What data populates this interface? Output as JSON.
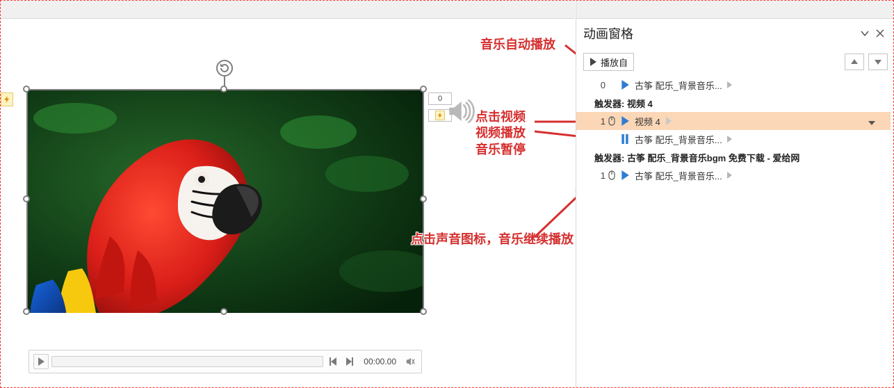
{
  "slide": {
    "index_label_1": "0",
    "index_label_2": "",
    "video_time": "00:00.00"
  },
  "annotations": {
    "auto_play": "音乐自动播放",
    "click_video_l1": "点击视频",
    "click_video_l2": "视频播放",
    "click_video_l3": "音乐暂停",
    "click_sound": "点击声音图标，音乐继续播放"
  },
  "pane": {
    "title": "动画窗格",
    "play_from": "播放自",
    "items": {
      "0": {
        "num": "0",
        "label": "古筝 配乐_背景音乐...",
        "kind": "play"
      },
      "trigger1": {
        "label": "触发器: 视频 4"
      },
      "1": {
        "num": "1",
        "label": "视频 4",
        "kind": "play",
        "mouse": true,
        "selected": true
      },
      "2": {
        "num": "",
        "label": "古筝 配乐_背景音乐...",
        "kind": "pause"
      },
      "trigger2": {
        "label": "触发器: 古筝 配乐_背景音乐bgm 免费下载 - 爱给网"
      },
      "3": {
        "num": "1",
        "label": "古筝 配乐_背景音乐...",
        "kind": "play",
        "mouse": true
      }
    }
  }
}
